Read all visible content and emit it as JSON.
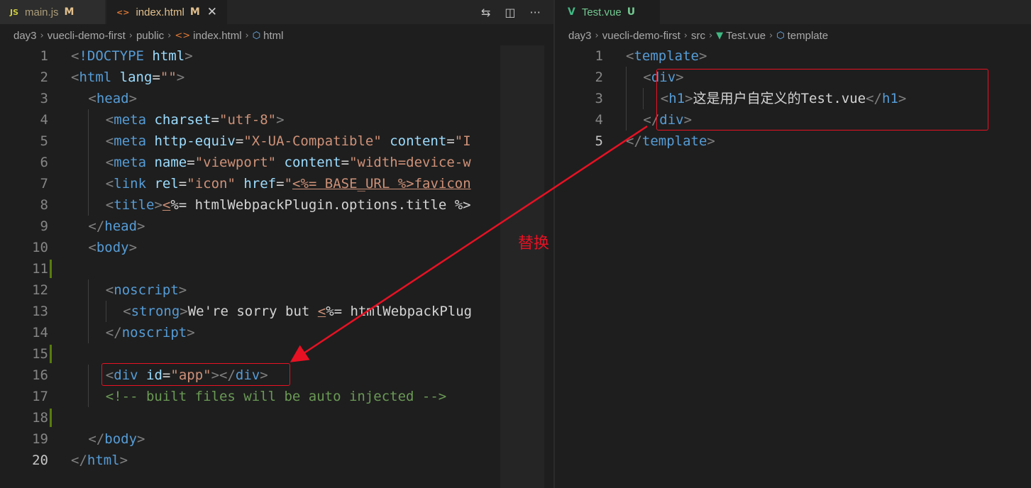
{
  "left_editor": {
    "tabs": [
      {
        "icon": "JS",
        "label": "main.js",
        "status": "M",
        "active": false
      },
      {
        "icon": "<>",
        "label": "index.html",
        "status": "M",
        "active": true,
        "close": "✕"
      }
    ],
    "breadcrumb": [
      "day3",
      "vuecli-demo-first",
      "public",
      "index.html",
      "html"
    ],
    "lines": [
      {
        "n": "1",
        "indent": 0,
        "tokens": [
          [
            "p",
            "<"
          ],
          [
            "tg",
            "!DOCTYPE"
          ],
          [
            "tx",
            " "
          ],
          [
            "at",
            "html"
          ],
          [
            "p",
            ">"
          ]
        ]
      },
      {
        "n": "2",
        "indent": 0,
        "tokens": [
          [
            "p",
            "<"
          ],
          [
            "tg",
            "html"
          ],
          [
            "tx",
            " "
          ],
          [
            "at",
            "lang"
          ],
          [
            "tx",
            "="
          ],
          [
            "sv",
            "\"\""
          ],
          [
            "p",
            ">"
          ]
        ]
      },
      {
        "n": "3",
        "indent": 1,
        "tokens": [
          [
            "p",
            "<"
          ],
          [
            "tg",
            "head"
          ],
          [
            "p",
            ">"
          ]
        ]
      },
      {
        "n": "4",
        "indent": 2,
        "tokens": [
          [
            "p",
            "<"
          ],
          [
            "tg",
            "meta"
          ],
          [
            "tx",
            " "
          ],
          [
            "at",
            "charset"
          ],
          [
            "tx",
            "="
          ],
          [
            "sv",
            "\"utf-8\""
          ],
          [
            "p",
            ">"
          ]
        ]
      },
      {
        "n": "5",
        "indent": 2,
        "tokens": [
          [
            "p",
            "<"
          ],
          [
            "tg",
            "meta"
          ],
          [
            "tx",
            " "
          ],
          [
            "at",
            "http-equiv"
          ],
          [
            "tx",
            "="
          ],
          [
            "sv",
            "\"X-UA-Compatible\""
          ],
          [
            "tx",
            " "
          ],
          [
            "at",
            "content"
          ],
          [
            "tx",
            "="
          ],
          [
            "sv",
            "\"I"
          ]
        ]
      },
      {
        "n": "6",
        "indent": 2,
        "tokens": [
          [
            "p",
            "<"
          ],
          [
            "tg",
            "meta"
          ],
          [
            "tx",
            " "
          ],
          [
            "at",
            "name"
          ],
          [
            "tx",
            "="
          ],
          [
            "sv",
            "\"viewport\""
          ],
          [
            "tx",
            " "
          ],
          [
            "at",
            "content"
          ],
          [
            "tx",
            "="
          ],
          [
            "sv",
            "\"width=device-w"
          ]
        ]
      },
      {
        "n": "7",
        "indent": 2,
        "tokens": [
          [
            "p",
            "<"
          ],
          [
            "tg",
            "link"
          ],
          [
            "tx",
            " "
          ],
          [
            "at",
            "rel"
          ],
          [
            "tx",
            "="
          ],
          [
            "sv",
            "\"icon\""
          ],
          [
            "tx",
            " "
          ],
          [
            "at",
            "href"
          ],
          [
            "tx",
            "="
          ],
          [
            "sv",
            "\""
          ],
          [
            "tpl",
            "<%= BASE_URL %>favicon"
          ]
        ]
      },
      {
        "n": "8",
        "indent": 2,
        "tokens": [
          [
            "p",
            "<"
          ],
          [
            "tg",
            "title"
          ],
          [
            "p",
            ">"
          ],
          [
            "tpl",
            "<"
          ],
          [
            "tx",
            "%= htmlWebpackPlugin.options.title %>"
          ]
        ]
      },
      {
        "n": "9",
        "indent": 1,
        "tokens": [
          [
            "p",
            "</"
          ],
          [
            "tg",
            "head"
          ],
          [
            "p",
            ">"
          ]
        ]
      },
      {
        "n": "10",
        "indent": 1,
        "tokens": [
          [
            "p",
            "<"
          ],
          [
            "tg",
            "body"
          ],
          [
            "p",
            ">"
          ]
        ]
      },
      {
        "n": "11",
        "indent": 0,
        "tokens": []
      },
      {
        "n": "12",
        "indent": 2,
        "tokens": [
          [
            "p",
            "<"
          ],
          [
            "tg",
            "noscript"
          ],
          [
            "p",
            ">"
          ]
        ]
      },
      {
        "n": "13",
        "indent": 3,
        "tokens": [
          [
            "p",
            "<"
          ],
          [
            "tg",
            "strong"
          ],
          [
            "p",
            ">"
          ],
          [
            "tx",
            "We're sorry but "
          ],
          [
            "tpl",
            "<"
          ],
          [
            "tx",
            "%= htmlWebpackPlug"
          ]
        ]
      },
      {
        "n": "14",
        "indent": 2,
        "tokens": [
          [
            "p",
            "</"
          ],
          [
            "tg",
            "noscript"
          ],
          [
            "p",
            ">"
          ]
        ]
      },
      {
        "n": "15",
        "indent": 0,
        "tokens": []
      },
      {
        "n": "16",
        "indent": 2,
        "tokens": [
          [
            "p",
            "<"
          ],
          [
            "tg",
            "div"
          ],
          [
            "tx",
            " "
          ],
          [
            "at",
            "id"
          ],
          [
            "tx",
            "="
          ],
          [
            "sv",
            "\"app\""
          ],
          [
            "p",
            "></"
          ],
          [
            "tg",
            "div"
          ],
          [
            "p",
            ">"
          ]
        ]
      },
      {
        "n": "17",
        "indent": 2,
        "tokens": [
          [
            "cm",
            "<!-- built files will be auto injected -->"
          ]
        ]
      },
      {
        "n": "18",
        "indent": 0,
        "tokens": []
      },
      {
        "n": "19",
        "indent": 1,
        "tokens": [
          [
            "p",
            "</"
          ],
          [
            "tg",
            "body"
          ],
          [
            "p",
            ">"
          ]
        ]
      },
      {
        "n": "20",
        "indent": 0,
        "tokens": [
          [
            "p",
            "</"
          ],
          [
            "tg",
            "html"
          ],
          [
            "p",
            ">"
          ]
        ]
      }
    ]
  },
  "right_editor": {
    "tabs": [
      {
        "icon": "V",
        "label": "Test.vue",
        "status": "U",
        "active": true
      }
    ],
    "breadcrumb": [
      "day3",
      "vuecli-demo-first",
      "src",
      "Test.vue",
      "template"
    ],
    "lines": [
      {
        "n": "1",
        "indent": 0,
        "tokens": [
          [
            "p",
            "<"
          ],
          [
            "tg",
            "template"
          ],
          [
            "p",
            ">"
          ]
        ]
      },
      {
        "n": "2",
        "indent": 2,
        "tokens": [
          [
            "p",
            "<"
          ],
          [
            "tg",
            "div"
          ],
          [
            "p",
            ">"
          ]
        ]
      },
      {
        "n": "3",
        "indent": 4,
        "tokens": [
          [
            "p",
            "<"
          ],
          [
            "tg",
            "h1"
          ],
          [
            "p",
            ">"
          ],
          [
            "tx",
            "这是用户自定义的Test.vue"
          ],
          [
            "p",
            "</"
          ],
          [
            "tg",
            "h1"
          ],
          [
            "p",
            ">"
          ]
        ]
      },
      {
        "n": "4",
        "indent": 2,
        "tokens": [
          [
            "p",
            "</"
          ],
          [
            "tg",
            "div"
          ],
          [
            "p",
            ">"
          ]
        ]
      },
      {
        "n": "5",
        "indent": 0,
        "tokens": [
          [
            "p",
            "</"
          ],
          [
            "tg",
            "template"
          ],
          [
            "p",
            ">"
          ]
        ]
      }
    ]
  },
  "annotation": {
    "label": "替换",
    "color": "#e81123"
  },
  "icons": {
    "compare": "⇆",
    "split": "◫",
    "more": "···"
  }
}
